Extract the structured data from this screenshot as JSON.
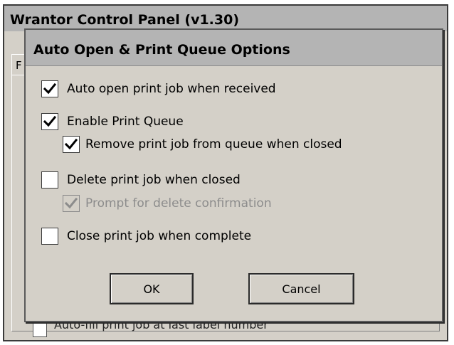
{
  "background_window": {
    "title": "Wrantor Control Panel (v1.30)",
    "tab_label": "F",
    "bottom_option_label": "Auto-fill print job at last label number"
  },
  "dialog": {
    "title": "Auto Open & Print Queue Options",
    "options": [
      {
        "label": "Auto open print job when received",
        "checked": true,
        "enabled": true
      },
      {
        "label": "Enable Print Queue",
        "checked": true,
        "enabled": true
      },
      {
        "label": "Remove print job from queue when closed",
        "checked": true,
        "enabled": true
      },
      {
        "label": "Delete print job when closed",
        "checked": false,
        "enabled": true
      },
      {
        "label": "Prompt for delete confirmation",
        "checked": true,
        "enabled": false
      },
      {
        "label": "Close print job when complete",
        "checked": false,
        "enabled": true
      }
    ],
    "ok_label": "OK",
    "cancel_label": "Cancel"
  }
}
